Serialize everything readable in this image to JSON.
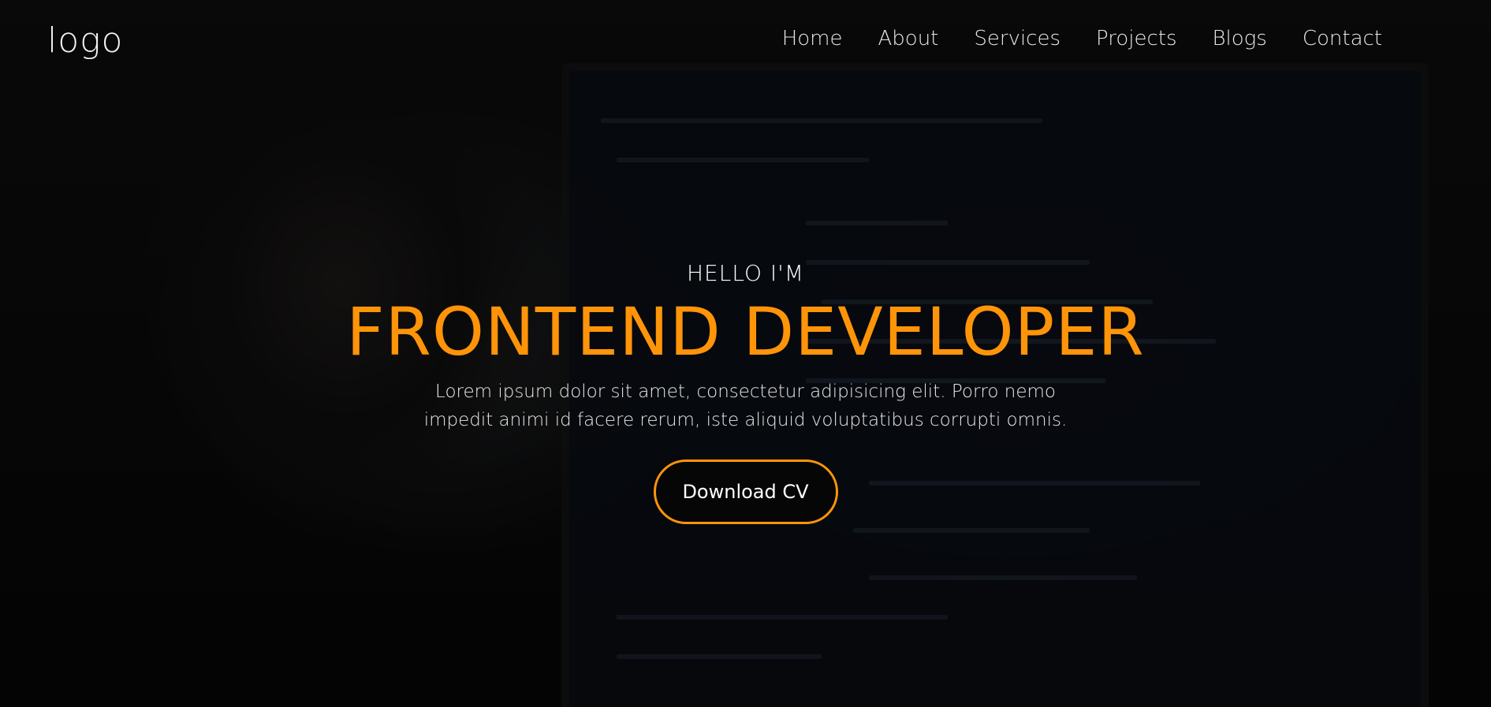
{
  "navbar": {
    "logo": "logo",
    "links": [
      "Home",
      "About",
      "Services",
      "Projects",
      "Blogs",
      "Contact"
    ]
  },
  "hero": {
    "greeting": "HELLO I'M",
    "headline": "FRONTEND DEVELOPER",
    "intro": "Lorem ipsum dolor sit amet, consectetur adipisicing elit. Porro nemo impedit animi id facere rerum, iste aliquid voluptatibus corrupti omnis.",
    "cta_label": "Download CV"
  },
  "colors": {
    "accent": "#ff9408",
    "text": "#ffffff",
    "background": "#0c0c0c"
  }
}
